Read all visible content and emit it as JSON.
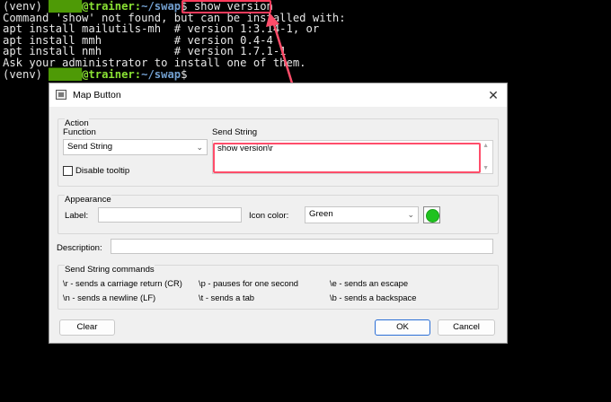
{
  "terminal": {
    "line1": {
      "venv": "(venv) ",
      "user": "█████",
      "host": "@trainer:",
      "path": "~/swap",
      "dollar": "$ ",
      "command": "show version"
    },
    "line2": "Command 'show' not found, but can be installed with:",
    "line3": "apt install mailutils-mh  # version 1:3.14-1, or",
    "line4": "apt install mmh           # version 0.4-4",
    "line5": "apt install nmh           # version 1.7.1-1",
    "line6": "Ask your administrator to install one of them.",
    "line7": {
      "venv": "(venv) ",
      "user": "█████",
      "host": "@trainer:",
      "path": "~/swap",
      "dollar": "$"
    }
  },
  "dialog": {
    "title": "Map Button",
    "close": "✕",
    "action": {
      "group_title": "Action",
      "function_label": "Function",
      "function_value": "Send String",
      "send_string_label": "Send String",
      "send_string_value": "show version\\r",
      "disable_tooltip_label": "Disable tooltip"
    },
    "appearance": {
      "group_title": "Appearance",
      "label_label": "Label:",
      "label_value": "",
      "icon_color_label": "Icon color:",
      "icon_color_value": "Green"
    },
    "description_label": "Description:",
    "description_value": "",
    "commands": {
      "group_title": "Send String commands",
      "items": [
        "\\r - sends a carriage return (CR)",
        "\\p - pauses for one second",
        "\\e - sends an escape",
        "\\n - sends a newline (LF)",
        "\\t - sends a tab",
        "\\b - sends a backspace"
      ]
    },
    "buttons": {
      "clear": "Clear",
      "ok": "OK",
      "cancel": "Cancel"
    }
  },
  "colors": {
    "accent_red": "#ff3b5c",
    "icon_green": "#1fc21f"
  }
}
